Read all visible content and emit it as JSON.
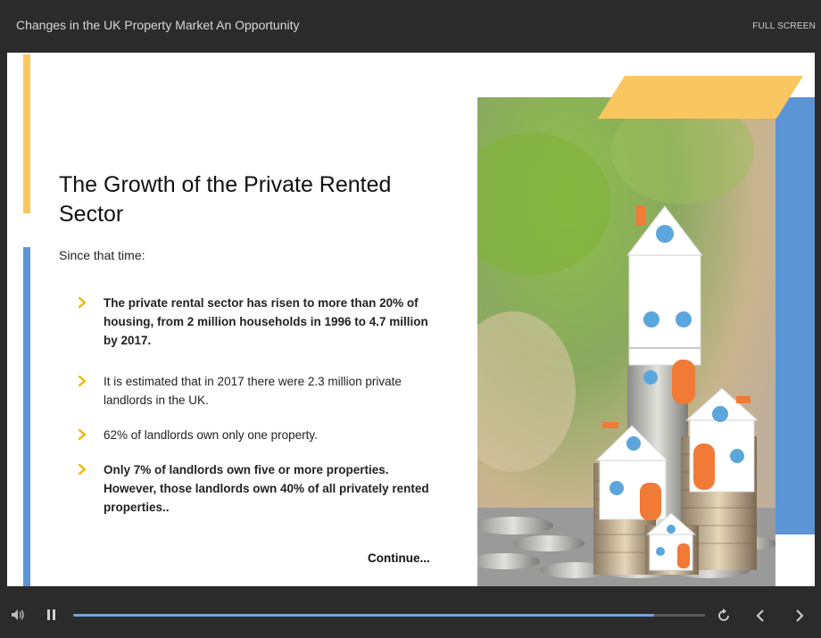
{
  "player": {
    "title": "Changes in the UK Property Market An Opportunity",
    "fullscreen_label": "FULL SCREEN",
    "progress": 0.92
  },
  "slide": {
    "title": "The Growth of the Private Rented Sector",
    "lead": "Since that time:",
    "bullets": [
      {
        "text": "The private rental sector has risen to more than 20% of housing, from 2 million households in 1996 to 4.7 million by 2017.",
        "bold": true
      },
      {
        "text": "It is estimated that in 2017 there were 2.3 million private landlords in the UK.",
        "bold": false
      },
      {
        "text": "62% of landlords own only one property.",
        "bold": false
      },
      {
        "text": "Only 7% of landlords own five or more properties. However, those landlords own 40% of all privately rented properties..",
        "bold": true
      }
    ],
    "continue_label": "Continue..."
  },
  "colors": {
    "accent_yellow": "#f9c660",
    "accent_blue": "#5c95d6",
    "bullet_chevron": "#f5b400"
  },
  "icons": {
    "volume": "volume-icon",
    "pause": "pause-icon",
    "replay": "replay-icon",
    "prev": "chevron-left-icon",
    "next": "chevron-right-icon",
    "bullet": "chevron-right-icon"
  }
}
